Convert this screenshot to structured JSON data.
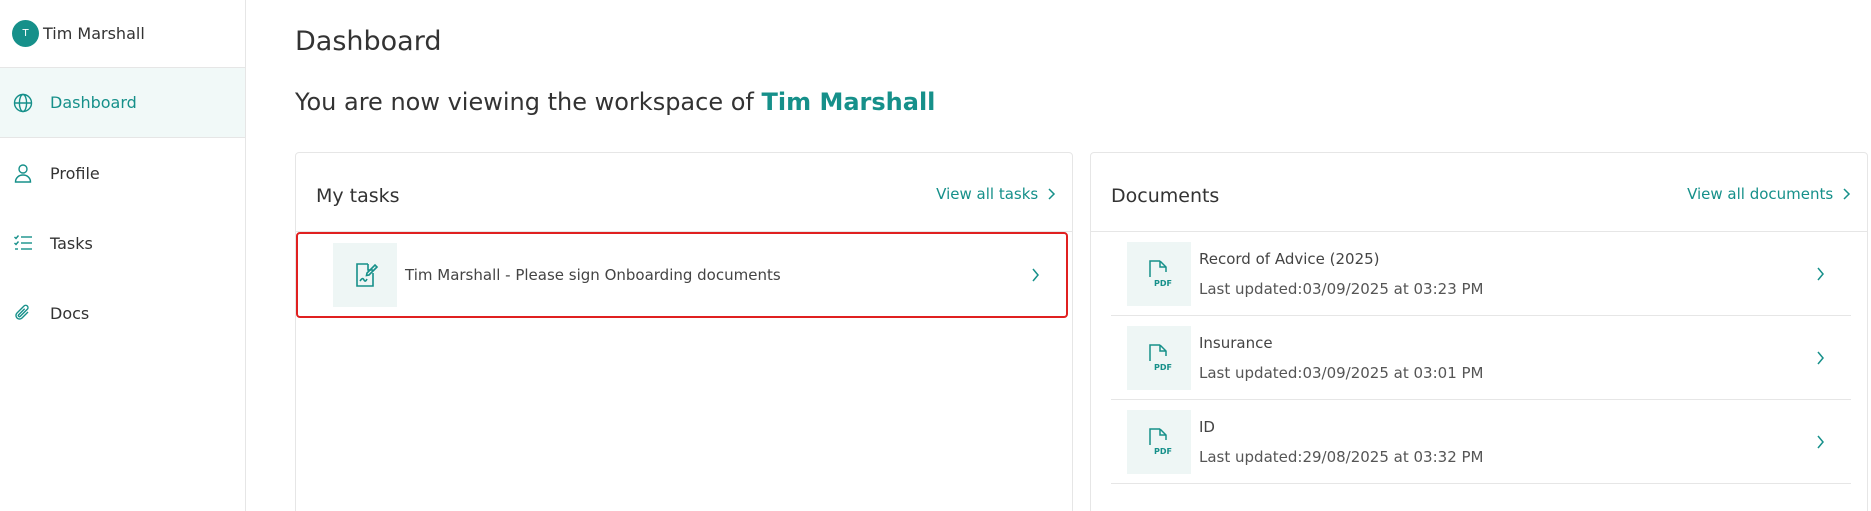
{
  "user": {
    "initial": "T",
    "name": "Tim Marshall"
  },
  "sidebar": {
    "items": [
      {
        "label": "Dashboard",
        "icon": "globe-icon",
        "active": true
      },
      {
        "label": "Profile",
        "icon": "user-icon",
        "active": false
      },
      {
        "label": "Tasks",
        "icon": "checklist-icon",
        "active": false
      },
      {
        "label": "Docs",
        "icon": "paperclip-icon",
        "active": false
      }
    ]
  },
  "page": {
    "title": "Dashboard",
    "workspace_prefix": "You are now viewing the workspace of ",
    "workspace_name": "Tim Marshall"
  },
  "tasks": {
    "title": "My tasks",
    "view_all": "View all tasks",
    "items": [
      {
        "label": "Tim Marshall - Please sign Onboarding documents",
        "icon": "sign-document-icon"
      }
    ]
  },
  "documents": {
    "title": "Documents",
    "view_all": "View all documents",
    "items": [
      {
        "name": "Record of Advice (2025)",
        "updated": "Last updated:03/09/2025 at 03:23 PM",
        "icon": "pdf-icon"
      },
      {
        "name": "Insurance",
        "updated": "Last updated:03/09/2025 at 03:01 PM",
        "icon": "pdf-icon"
      },
      {
        "name": "ID",
        "updated": "Last updated:29/08/2025 at 03:32 PM",
        "icon": "pdf-icon"
      }
    ]
  },
  "colors": {
    "accent": "#16908a",
    "highlight": "#e02020",
    "tile_bg": "#eef6f5"
  }
}
